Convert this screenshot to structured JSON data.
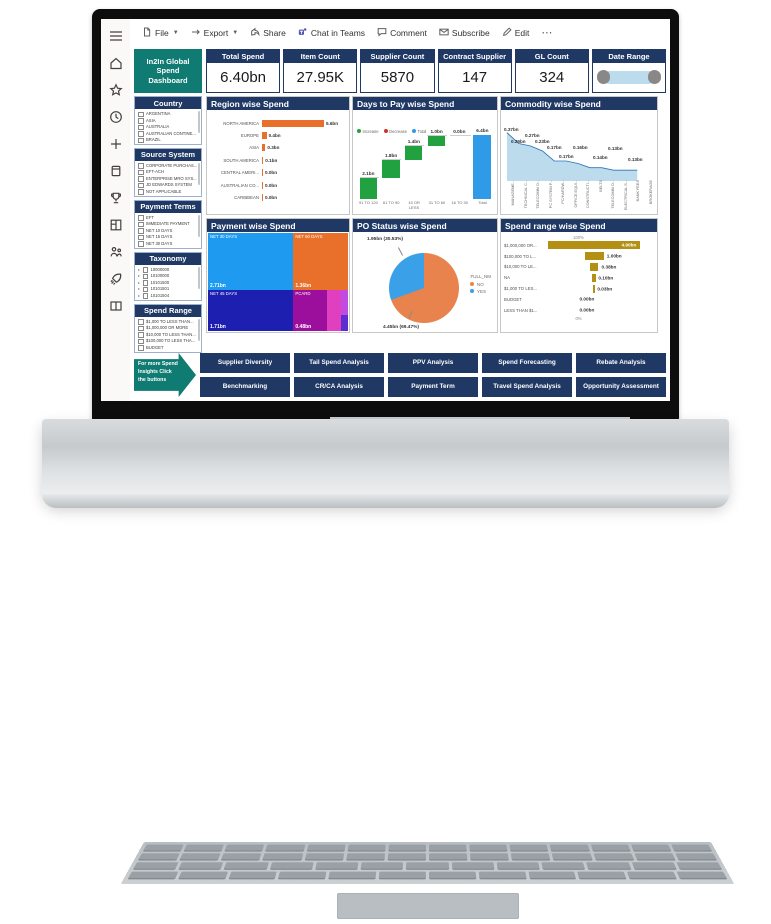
{
  "app": {
    "nav_items": [
      {
        "name": "menu-icon",
        "label": "Menu"
      },
      {
        "name": "home-icon",
        "label": "Home"
      },
      {
        "name": "star-icon",
        "label": "Favorites"
      },
      {
        "name": "clock-icon",
        "label": "Recent"
      },
      {
        "name": "plus-icon",
        "label": "Create"
      },
      {
        "name": "dataset-icon",
        "label": "Datasets"
      },
      {
        "name": "trophy-icon",
        "label": "Goals"
      },
      {
        "name": "apps-icon",
        "label": "Apps"
      },
      {
        "name": "people-icon",
        "label": "Shared with me"
      },
      {
        "name": "rocket-icon",
        "label": "Deployment pipelines"
      },
      {
        "name": "book-icon",
        "label": "Learn"
      }
    ],
    "commandbar": [
      {
        "label": "File",
        "icon": "file-icon",
        "caret": true
      },
      {
        "label": "Export",
        "icon": "export-icon",
        "caret": true
      },
      {
        "label": "Share",
        "icon": "share-icon",
        "caret": false
      },
      {
        "label": "Chat in Teams",
        "icon": "teams-icon",
        "caret": false
      },
      {
        "label": "Comment",
        "icon": "comment-icon",
        "caret": false
      },
      {
        "label": "Subscribe",
        "icon": "subscribe-icon",
        "caret": false
      },
      {
        "label": "Edit",
        "icon": "edit-icon",
        "caret": false
      }
    ],
    "overflow_label": "⋯"
  },
  "report": {
    "title": "In2In Global Spend Dashboard",
    "kpis": [
      {
        "label": "Total Spend",
        "value": "6.40bn"
      },
      {
        "label": "Item Count",
        "value": "27.95K"
      },
      {
        "label": "Supplier Count",
        "value": "5870"
      },
      {
        "label": "Contract Supplier",
        "value": "147"
      },
      {
        "label": "GL Count",
        "value": "324"
      }
    ],
    "date_range": {
      "label": "Date Range",
      "control": "range-slider"
    },
    "slicers": [
      {
        "title": "Country",
        "items": [
          "ARGENTINA",
          "ASIA",
          "AUSTRALIA",
          "AUSTRALIAN CONTINE...",
          "BRAZIL"
        ],
        "expandable": false
      },
      {
        "title": "Source System",
        "items": [
          "CORPORATE PURCHAS...",
          "EFT-ACH",
          "ENTERPRISE MRO SYS...",
          "JD EDWARDS SYSTEM",
          "NOT APPLICABLE"
        ],
        "expandable": false
      },
      {
        "title": "Payment Terms",
        "items": [
          "EFT",
          "IMMEDIATE PAYMENT",
          "NET 10 DAYS",
          "NET 15 DAYS",
          "NET 30 DAYS"
        ],
        "expandable": false
      },
      {
        "title": "Taxonomy",
        "items": [
          "10000000",
          "10100000",
          "10101500",
          "10101501",
          "10101504"
        ],
        "expandable": true
      },
      {
        "title": "Spend Range",
        "items": [
          "$1,000 TO LESS THAN...",
          "$1,000,000 OR MORE",
          "$10,000 TO LESS THAN...",
          "$100,000 TO LESS THA...",
          "BUDGET"
        ],
        "expandable": false
      }
    ],
    "buttons_callout": "For more Spend Insights Click the buttons",
    "buttons": [
      "Supplier Diversity",
      "Tail Spend Analysis",
      "PPV Analysis",
      "Spend Forecasting",
      "Rebate Analysis",
      "Benchmarking",
      "CR/CA Analysis",
      "Payment Term",
      "Travel Spend Analysis",
      "Opportunity Assessment"
    ]
  },
  "chart_data": [
    {
      "type": "bar",
      "title": "Region wise Spend",
      "orientation": "horizontal",
      "categories": [
        "NORTH AMERICA",
        "EUROPE",
        "ASIA",
        "SOUTH AMERICA",
        "CENTRAL AMERI...",
        "AUSTRALIAN CO...",
        "CARIBBEAN"
      ],
      "values": [
        5.6,
        0.4,
        0.3,
        0.1,
        0.0,
        0.0,
        0.0
      ],
      "labels": [
        "5.6bn",
        "0.4bn",
        "0.3bn",
        "0.1bn",
        "0.0bn",
        "0.0bn",
        "0.0bn"
      ],
      "color": "#e8702a",
      "xlabel": "",
      "ylabel": "",
      "grid": false,
      "legend": false
    },
    {
      "type": "bar",
      "subtype": "waterfall",
      "title": "Days to Pay wise Spend",
      "legend": [
        "Increase",
        "Decrease",
        "Total"
      ],
      "legend_colors": [
        "#21a13f",
        "#c8332a",
        "#2f9ae8"
      ],
      "legend_position": "top-left",
      "categories": [
        "91 TO 120",
        "61 TO 90",
        "15 OR LESS",
        "31 TO 60",
        "16 TO 30",
        "Total"
      ],
      "values": [
        2.1,
        1.8,
        1.4,
        1.0,
        0.0,
        6.4
      ],
      "labels": [
        "2.1bn",
        "1.8bn",
        "1.4bn",
        "1.0bn",
        "0.0bn",
        "6.4bn"
      ],
      "cumulative": [
        2.1,
        3.9,
        5.3,
        6.3,
        6.3,
        6.4
      ],
      "ylim": [
        0,
        6.4
      ]
    },
    {
      "type": "area",
      "title": "Commodity wise Spend",
      "categories": [
        "MANAGEME...",
        "TECHNICAL C...",
        "TELECOMM O...",
        "PC SYSTEM P...",
        "PC/HARDW...",
        "OFFICE EQUI...",
        "CONSTRUCTI...",
        "BELTS",
        "TELECOMM O...",
        "ELECTRICAL S...",
        "BANK FEES",
        "BROKERAGE"
      ],
      "values": [
        0.37,
        0.29,
        0.27,
        0.23,
        0.17,
        0.17,
        0.16,
        0.14,
        0.14,
        0.13,
        0.13,
        0.13
      ],
      "labels": [
        "0.37bn",
        "0.29bn",
        "0.27bn",
        "0.23bn",
        "0.17bn",
        "0.17bn",
        "0.16bn",
        "0.14bn",
        "0.14bn",
        "0.13bn",
        "0.13bn",
        "0.13bn"
      ],
      "color": "#bcdcee",
      "line_color": "#2e75b6",
      "ylim": [
        0,
        0.42
      ]
    },
    {
      "type": "treemap",
      "title": "Payment wise Spend",
      "items": [
        {
          "name": "NET 30 DAYS",
          "value": "2.71bn",
          "color": "#1e9bf0"
        },
        {
          "name": "NET 60 DAYS",
          "value": "1.36bn",
          "color": "#e8702a"
        },
        {
          "name": "NET 45 DAYS",
          "value": "1.71bn",
          "color": "#1d1fb0"
        },
        {
          "name": "PCARD",
          "value": "0.48bn",
          "color": "#9c0f9c"
        },
        {
          "name": "",
          "value": "",
          "color": "#e040c0"
        },
        {
          "name": "",
          "value": "",
          "color": "#c14be0"
        },
        {
          "name": "",
          "value": "",
          "color": "#5b2fd0"
        }
      ]
    },
    {
      "type": "pie",
      "title": "PO Status wise Spend",
      "legend_title": "FULL_NM",
      "labels": [
        "NO",
        "YES"
      ],
      "values": [
        4.45,
        1.95
      ],
      "percent": [
        "69.47%",
        "30.53%"
      ],
      "callouts": [
        "1.95bn (30.53%)",
        "4.45bn (69.47%)"
      ],
      "colors": [
        "#e8834e",
        "#3aa0e8"
      ],
      "legend_position": "right"
    },
    {
      "type": "bar",
      "subtype": "funnel",
      "title": "Spend range wise Spend",
      "axis_top": "100%",
      "axis_bottom": "0%",
      "categories": [
        "$1,000,000 OR...",
        "$100,000 TO L...",
        "$10,000 TO LE...",
        "NA",
        "$1,000 TO LES...",
        "BUDGET",
        "LESS THAN $1..."
      ],
      "values": [
        4.9,
        1.0,
        0.38,
        0.1,
        0.03,
        0.0,
        0.0
      ],
      "labels": [
        "4.90bn",
        "1.00bn",
        "0.38bn",
        "0.10bn",
        "0.03bn",
        "0.00bn",
        "0.00bn"
      ],
      "color": "#b39014"
    }
  ]
}
